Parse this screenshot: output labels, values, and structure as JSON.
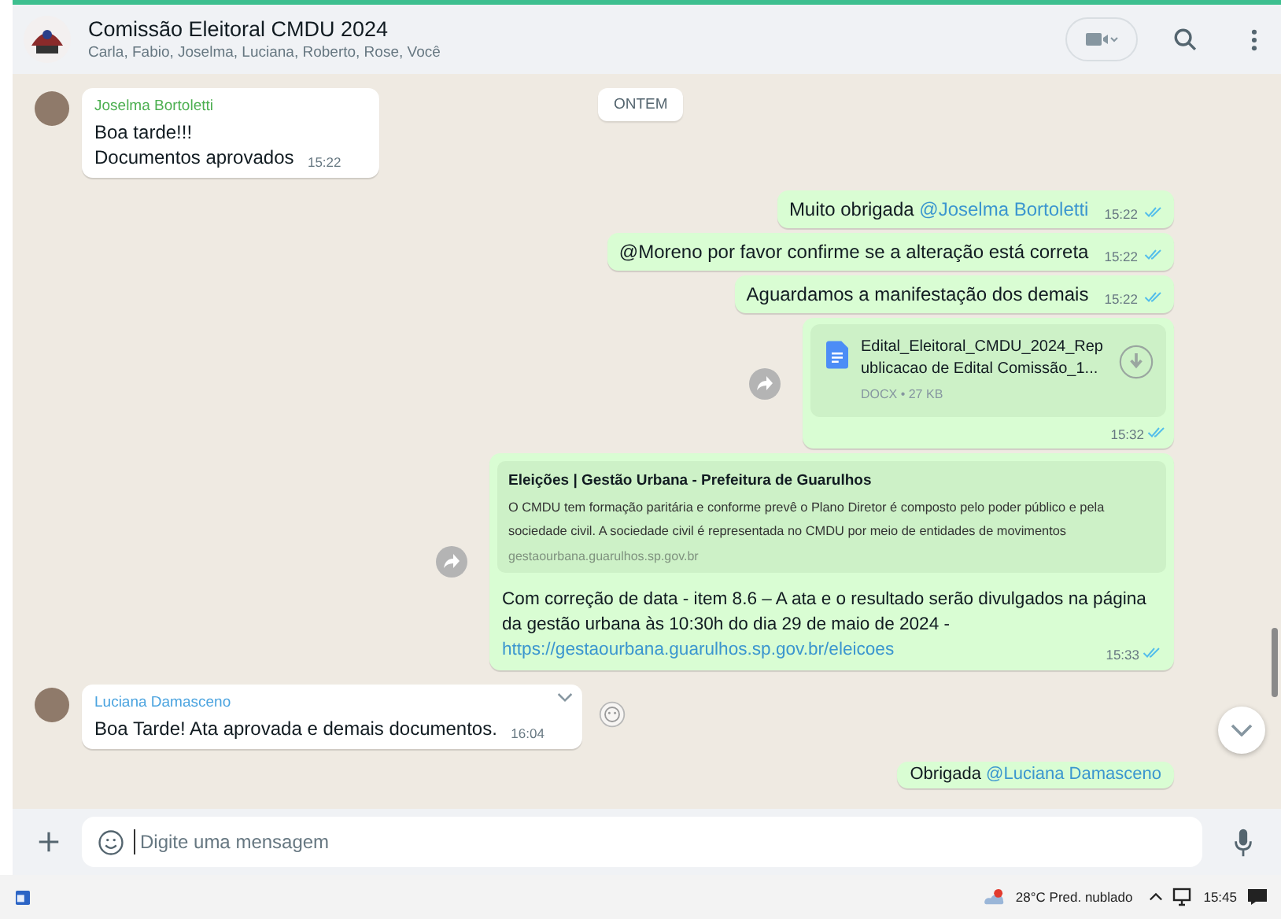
{
  "header": {
    "title": "Comissão Eleitoral CMDU 2024",
    "members": "Carla, Fabio, Joselma, Luciana, Roberto, Rose, Você"
  },
  "date_chip": "ONTEM",
  "messages": [
    {
      "kind": "incoming",
      "sender": "Joselma Bortoletti",
      "color": "#4caf50",
      "lines": [
        "Boa tarde!!!",
        "Documentos aprovados"
      ],
      "time": "15:22"
    },
    {
      "kind": "outgoing",
      "text": "Muito obrigada ",
      "mention": "@Joselma Bortoletti",
      "time": "15:22",
      "read": true
    },
    {
      "kind": "outgoing",
      "text": "@Moreno por favor confirme se a alteração está correta",
      "time": "15:22",
      "read": true
    },
    {
      "kind": "outgoing",
      "text": "Aguardamos a manifestação dos demais",
      "time": "15:22",
      "read": true
    },
    {
      "kind": "document",
      "file_name": "Edital_Eleitoral_CMDU_2024_Republicacao de Edital Comissão_1...",
      "file_info": "DOCX • 27 KB",
      "time": "15:32",
      "read": true
    },
    {
      "kind": "link",
      "preview_title": "Eleições | Gestão Urbana - Prefeitura de Guarulhos",
      "preview_text": "O CMDU tem formação paritária e conforme prevê o Plano Diretor é composto pelo poder público e pela sociedade civil. A sociedade civil é representada no CMDU por meio de entidades de movimentos",
      "preview_domain": "gestaourbana.guarulhos.sp.gov.br",
      "text": "Com correção de data - item 8.6 – A ata e o resultado serão divulgados na página da gestão urbana às 10:30h do dia 29 de maio de 2024 -",
      "url": "https://gestaourbana.guarulhos.sp.gov.br/eleicoes",
      "time": "15:33",
      "read": true
    },
    {
      "kind": "incoming",
      "sender": "Luciana Damasceno",
      "color": "#4aa3df",
      "lines": [
        "Boa Tarde! Ata aprovada e demais documentos."
      ],
      "time": "16:04"
    },
    {
      "kind": "outgoing",
      "text": "Obrigada ",
      "mention": "@Luciana Damasceno"
    }
  ],
  "composer": {
    "placeholder": "Digite uma mensagem"
  },
  "taskbar": {
    "weather": "28°C Pred. nublado",
    "clock": "15:45"
  }
}
